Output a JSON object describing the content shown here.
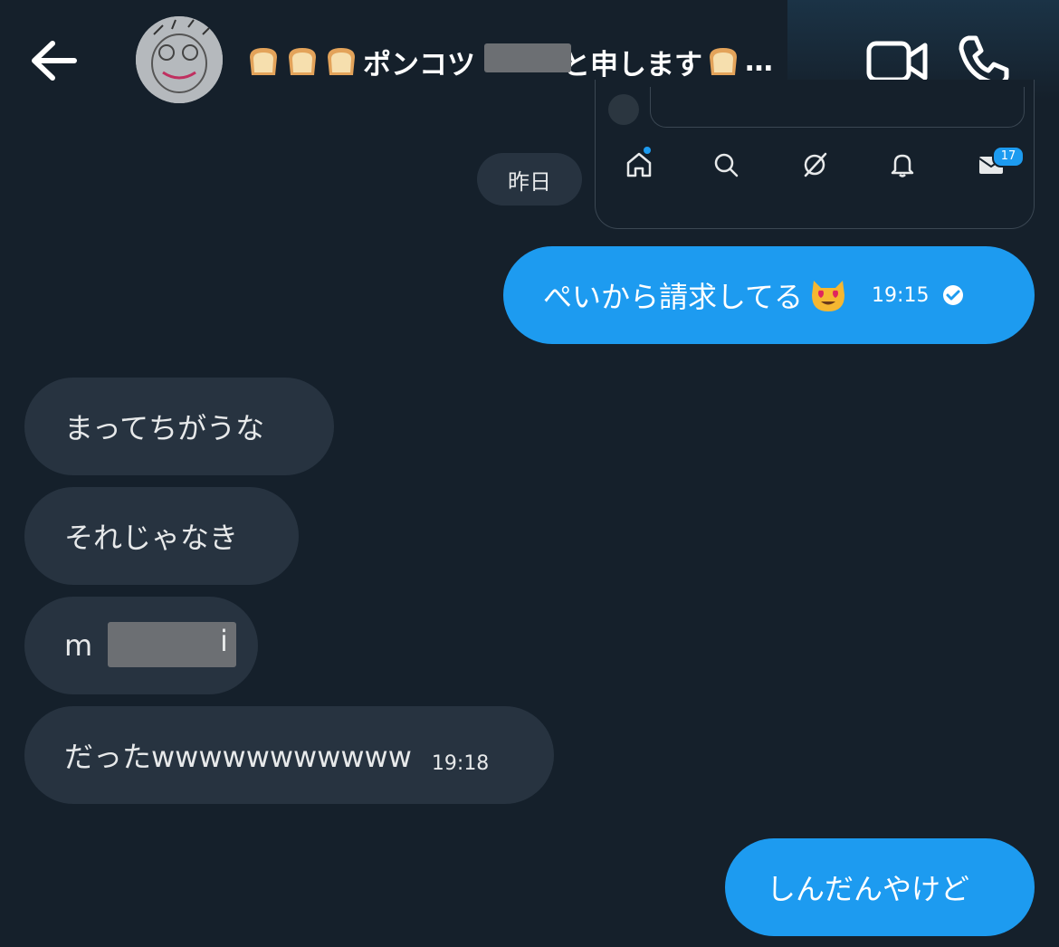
{
  "header": {
    "title": "ポンコツ",
    "title_suffix": "と申します",
    "ellipsis": "…",
    "bread_icon": "bread-emoji-icon",
    "back_icon": "arrow-left-icon",
    "video_icon": "video-camera-icon",
    "call_icon": "phone-icon"
  },
  "preview_card": {
    "nav_icons": [
      "home-icon",
      "search-icon",
      "grok-icon",
      "bell-icon",
      "mail-icon"
    ],
    "mail_badge": "17"
  },
  "date_separator": "昨日",
  "messages": [
    {
      "direction": "out",
      "text": "ぺいから請求してる",
      "emoji": "heart-eyes-cat-emoji",
      "time": "19:15",
      "status_icon": "check-circle-icon"
    },
    {
      "direction": "in",
      "text": "まってちがうな"
    },
    {
      "direction": "in",
      "text": "それじゃなき"
    },
    {
      "direction": "in",
      "text_start": "m",
      "text_end": "i"
    },
    {
      "direction": "in",
      "text": "だったwwwwwwwwwww",
      "time": "19:18"
    },
    {
      "direction": "out",
      "text": "しんだんやけど"
    }
  ],
  "colors": {
    "background": "#15202b",
    "outgoing_bubble": "#1d9bf0",
    "incoming_bubble": "#273340",
    "redaction": "#6c6f73"
  }
}
